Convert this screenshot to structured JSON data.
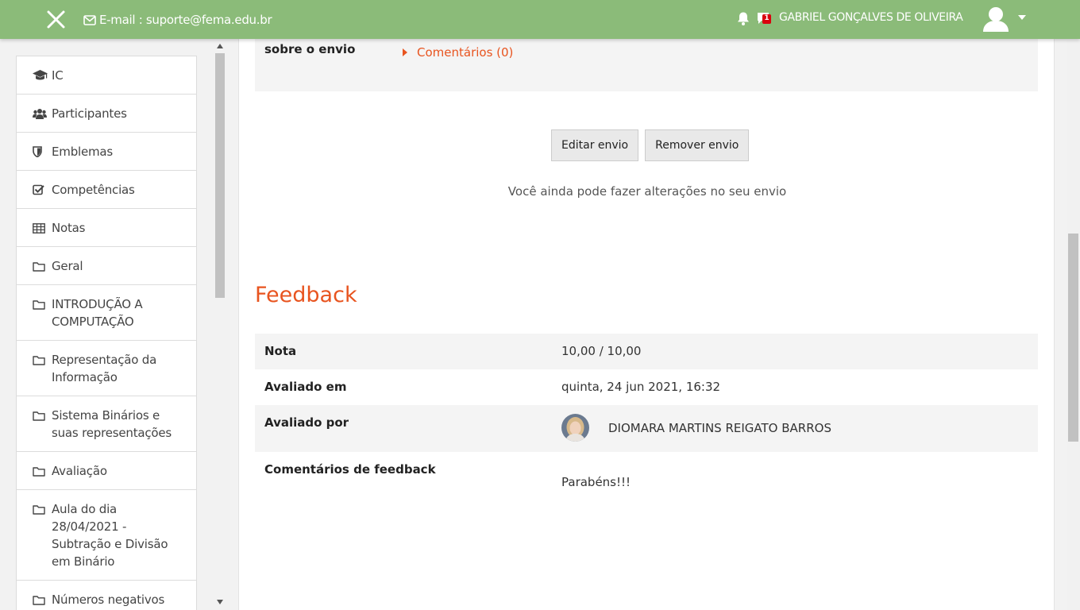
{
  "navbar": {
    "email_text": "E-mail : suporte@fema.edu.br",
    "message_count": "1",
    "user_name": "GABRIEL GONÇALVES DE OLIVEIRA",
    "color": "#8bbb79"
  },
  "drawer": {
    "items": [
      {
        "label": "IC",
        "icon": "graduation-cap-icon"
      },
      {
        "label": "Participantes",
        "icon": "users-icon"
      },
      {
        "label": "Emblemas",
        "icon": "shield-icon"
      },
      {
        "label": "Competências",
        "icon": "check-square-icon"
      },
      {
        "label": "Notas",
        "icon": "table-icon"
      },
      {
        "label": "Geral",
        "icon": "folder-icon"
      },
      {
        "label": "INTRODUÇÃO A COMPUTAÇÃO",
        "icon": "folder-icon"
      },
      {
        "label": "Representação da Informação",
        "icon": "folder-icon"
      },
      {
        "label": "Sistema Binários e suas representações",
        "icon": "folder-icon"
      },
      {
        "label": "Avaliação",
        "icon": "folder-icon"
      },
      {
        "label": "Aula do dia 28/04/2021 - Subtração e Divisão em Binário",
        "icon": "folder-icon"
      },
      {
        "label": "Números negativos em Binário -",
        "icon": "folder-icon"
      }
    ]
  },
  "submission": {
    "label": "sobre o envio",
    "comments_link": "Comentários (0)",
    "edit_button": "Editar envio",
    "remove_button": "Remover envio",
    "note": "Você ainda pode fazer alterações no seu envio"
  },
  "feedback": {
    "heading": "Feedback",
    "rows": {
      "grade": {
        "key": "Nota",
        "value": "10,00 / 10,00"
      },
      "graded_on": {
        "key": "Avaliado em",
        "value": "quinta, 24 jun 2021, 16:32"
      },
      "graded_by": {
        "key": "Avaliado por",
        "value": "DIOMARA MARTINS REIGATO BARROS"
      },
      "comments": {
        "key": "Comentários de feedback",
        "value": "Parabéns!!!"
      }
    }
  },
  "colors": {
    "accent": "#e8541f",
    "navbar": "#8bbb79"
  }
}
